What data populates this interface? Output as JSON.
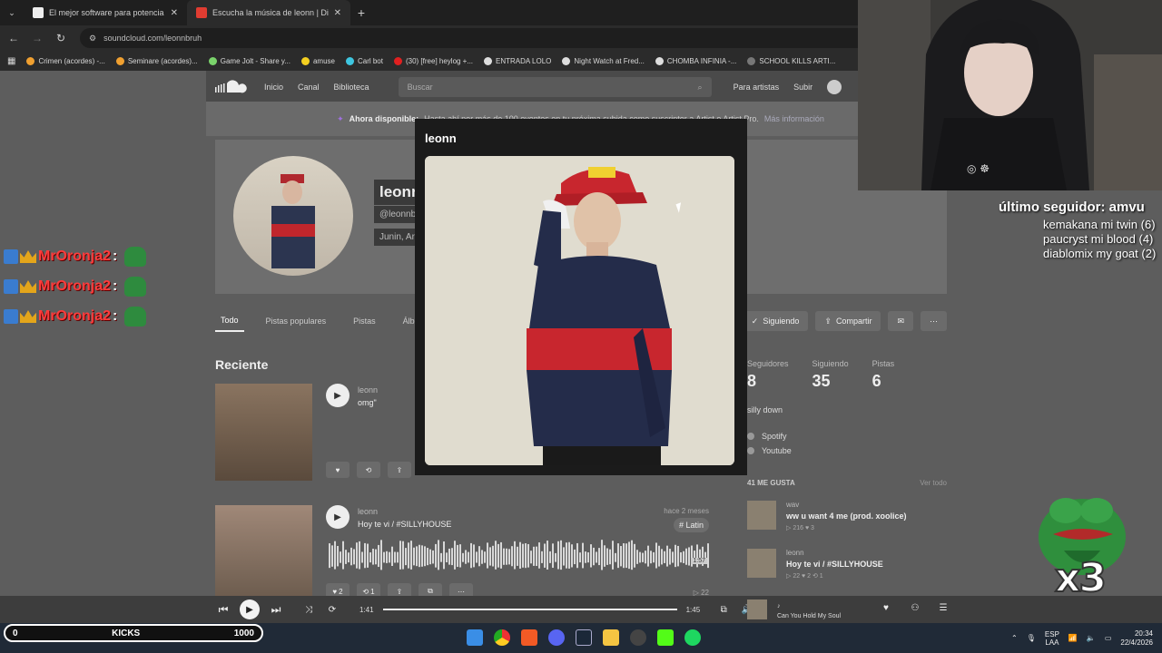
{
  "browser": {
    "tabs": [
      {
        "title": "El mejor software para potencia",
        "active": false,
        "color": "#f0f0f0"
      },
      {
        "title": "Escucha la música de leonn | Di",
        "active": true,
        "color": "#e03c31"
      }
    ],
    "url": "soundcloud.com/leonnbruh",
    "bookmarks": [
      "Crimen (acordes) -...",
      "Seminare (acordes)...",
      "Game Jolt - Share y...",
      "amuse",
      "Carl bot",
      "(30) [free] heylog +...",
      "ENTRADA LOLO",
      "Night Watch at Fred...",
      "CHOMBA INFINIA -...",
      "SCHOOL KILLS ARTI..."
    ]
  },
  "header": {
    "nav": [
      "Inicio",
      "Canal",
      "Biblioteca"
    ],
    "search_placeholder": "Buscar",
    "right": [
      "Para artistas",
      "Subir"
    ]
  },
  "banner": {
    "bold": "Ahora disponible:",
    "text": "Hasta ahí por más de 100 oyentes en tu próxima subida como suscriptor a Artist o Artist Pro.",
    "more": "Más información"
  },
  "profile": {
    "name": "leonn",
    "handle": "@leonnbruh",
    "location": "Junin, Ar"
  },
  "profile_tabs": [
    "Todo",
    "Pistas populares",
    "Pistas",
    "Álbumes"
  ],
  "profile_actions": {
    "following": "Siguiendo",
    "share": "Compartir"
  },
  "recent_heading": "Reciente",
  "tracks": [
    {
      "artist": "leonn",
      "title": "omg\"",
      "ago": "",
      "tag": ""
    },
    {
      "artist": "leonn",
      "title": "Hoy te vi / #SILLYHOUSE",
      "ago": "hace 2 meses",
      "tag": "# Latin",
      "duration": "1:57",
      "plays": "22",
      "likes": "2",
      "reposts": "1"
    }
  ],
  "stats": [
    {
      "label": "Seguidores",
      "value": "8"
    },
    {
      "label": "Siguiendo",
      "value": "35"
    },
    {
      "label": "Pistas",
      "value": "6"
    }
  ],
  "bio": "silly down",
  "links": [
    "Spotify",
    "Youtube"
  ],
  "likes": {
    "heading": "41 ME GUSTA",
    "see_all": "Ver todo",
    "items": [
      {
        "artist": "wav",
        "title": "ww u want 4 me (prod. xoolice)",
        "stats": "▷ 216  ♥ 3"
      },
      {
        "artist": "leonn",
        "title": "Hoy te vi / #SILLYHOUSE",
        "stats": "▷ 22  ♥ 2  ⟲ 1"
      }
    ]
  },
  "modal": {
    "title": "leonn"
  },
  "player": {
    "elapsed": "1:41",
    "total": "1:45",
    "progress": 1.0,
    "now_artist": "♪",
    "now_title": "Can You Hold My Soul"
  },
  "stream": {
    "last_follower": "último seguidor: amvu",
    "top_followers": [
      "kemakana mi twin (6)",
      "paucryst mi blood (4)",
      "diablomix my goat (2)"
    ],
    "chat_user": "MrOronja2",
    "chat_sep": ":",
    "kicks_label": "KICKS",
    "kicks_start": "0",
    "kicks_goal": "1000",
    "multiplier": "x3"
  },
  "taskbar": {
    "lang": "ESP",
    "lang2": "LAA",
    "time": "20:34",
    "date": "22/4/2026"
  }
}
